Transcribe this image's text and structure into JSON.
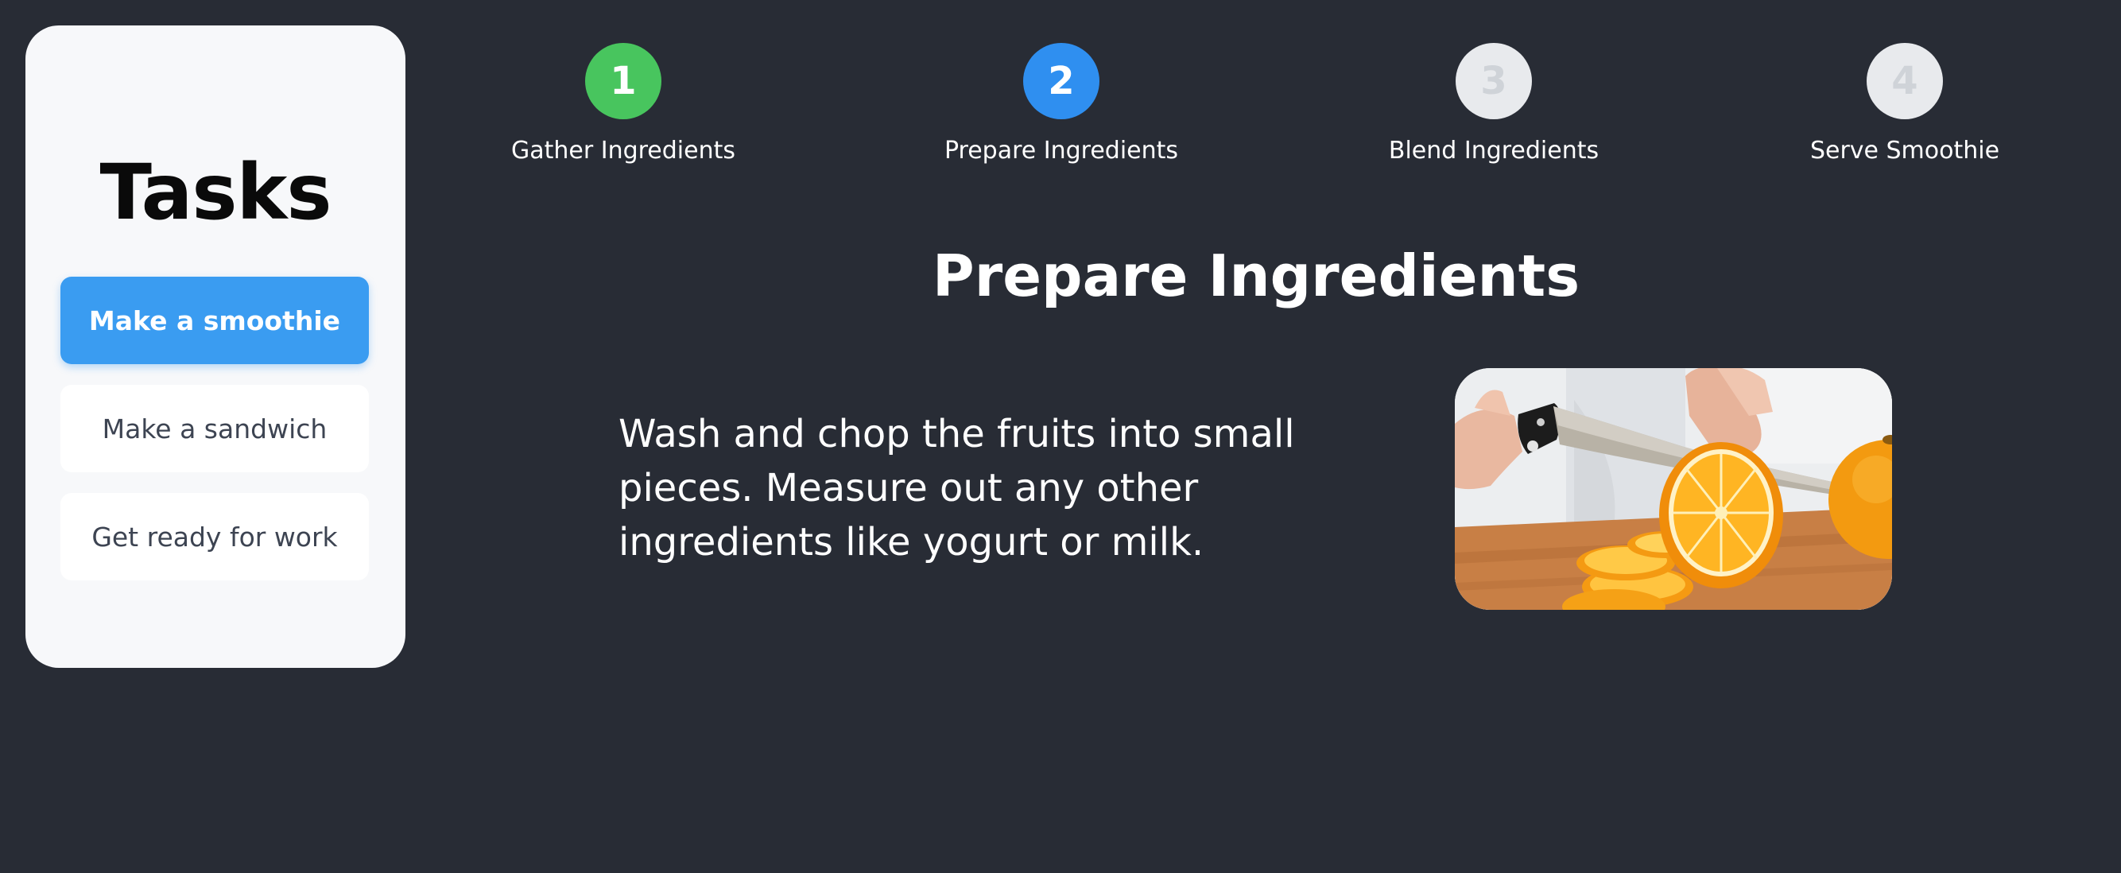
{
  "sidebar": {
    "title": "Tasks",
    "tasks": [
      {
        "label": "Make a smoothie",
        "active": true
      },
      {
        "label": "Make a sandwich",
        "active": false
      },
      {
        "label": "Get ready for work",
        "active": false
      }
    ]
  },
  "stepper": {
    "steps": [
      {
        "number": "1",
        "label": "Gather Ingredients",
        "state": "completed"
      },
      {
        "number": "2",
        "label": "Prepare Ingredients",
        "state": "current"
      },
      {
        "number": "3",
        "label": "Blend Ingredients",
        "state": "upcoming"
      },
      {
        "number": "4",
        "label": "Serve Smoothie",
        "state": "upcoming"
      }
    ]
  },
  "main": {
    "heading": "Prepare Ingredients",
    "description": "Wash and chop the fruits into small pieces. Measure out any other ingredients like yogurt or milk.",
    "image_subject": "orange-being-sliced-with-knife"
  },
  "colors": {
    "page_background": "#282c35",
    "sidebar_background": "#f7f8fa",
    "accent_blue": "#3a9cf1",
    "step_completed": "#48c55e",
    "step_current": "#2f8ff0",
    "step_upcoming": "#e8eaed"
  }
}
